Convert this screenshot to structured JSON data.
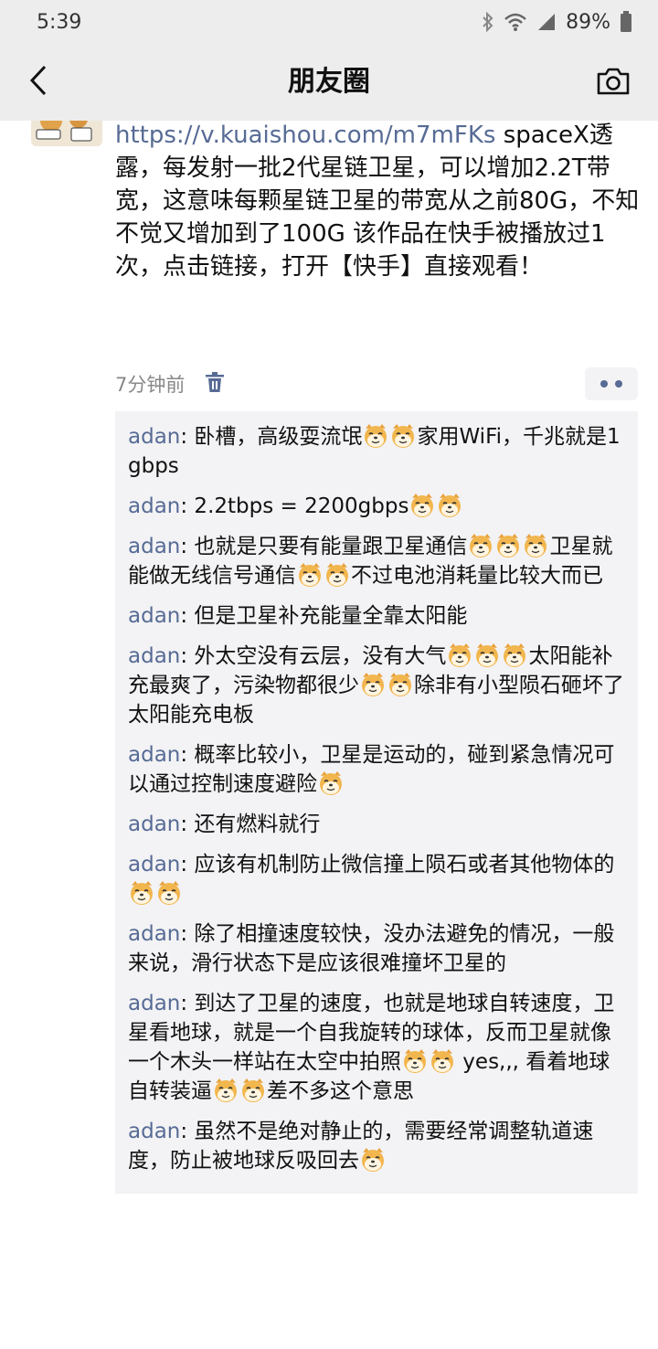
{
  "status": {
    "time": "5:39",
    "battery": "89%"
  },
  "nav": {
    "title": "朋友圈",
    "back_icon": "chevron-left-icon",
    "camera_icon": "camera-icon"
  },
  "post": {
    "link": "https://v.kuaishou.com/m7mFKs",
    "text": " spaceX透露，每发射一批2代星链卫星，可以增加2.2T带宽，这意味每颗星链卫星的带宽从之前80G，不知不觉又增加到了100G 该作品在快手被播放过1次，点击链接，打开【快手】直接观看！",
    "time": "7分钟前"
  },
  "comments": [
    {
      "author": "adan",
      "segments": [
        ": 卧槽，高级耍流氓",
        "emo",
        "emo",
        "家用WiFi，千兆就是1gbps"
      ]
    },
    {
      "author": "adan",
      "segments": [
        ": 2.2tbps = 2200gbps",
        "emo",
        "emo"
      ]
    },
    {
      "author": "adan",
      "segments": [
        ": 也就是只要有能量跟卫星通信",
        "emo",
        "emo",
        "emo",
        "卫星就能做无线信号通信",
        "emo",
        "emo",
        "不过电池消耗量比较大而已"
      ]
    },
    {
      "author": "adan",
      "segments": [
        ": 但是卫星补充能量全靠太阳能"
      ]
    },
    {
      "author": "adan",
      "segments": [
        ": 外太空没有云层，没有大气",
        "emo",
        "emo",
        "emo",
        "太阳能补充最爽了，污染物都很少",
        "emo",
        "emo",
        "除非有小型陨石砸坏了太阳能充电板"
      ]
    },
    {
      "author": "adan",
      "segments": [
        ": 概率比较小，卫星是运动的，碰到紧急情况可以通过控制速度避险",
        "emo"
      ]
    },
    {
      "author": "adan",
      "segments": [
        ": 还有燃料就行"
      ]
    },
    {
      "author": "adan",
      "segments": [
        ": 应该有机制防止微信撞上陨石或者其他物体的",
        "emo",
        "emo"
      ]
    },
    {
      "author": "adan",
      "segments": [
        ": 除了相撞速度较快，没办法避免的情况，一般来说，滑行状态下是应该很难撞坏卫星的"
      ]
    },
    {
      "author": "adan",
      "segments": [
        ": 到达了卫星的速度，也就是地球自转速度，卫星看地球，就是一个自我旋转的球体，反而卫星就像一个木头一样站在太空中拍照",
        "emo",
        "emo",
        " yes,,, 看着地球自转装逼",
        "emo",
        "emo",
        "差不多这个意思"
      ]
    },
    {
      "author": "adan",
      "segments": [
        ": 虽然不是绝对静止的，需要经常调整轨道速度，防止被地球反吸回去",
        "emo"
      ]
    }
  ],
  "colors": {
    "link": "#576b95",
    "background": "#ededed",
    "comment_bg": "#f3f3f5"
  }
}
